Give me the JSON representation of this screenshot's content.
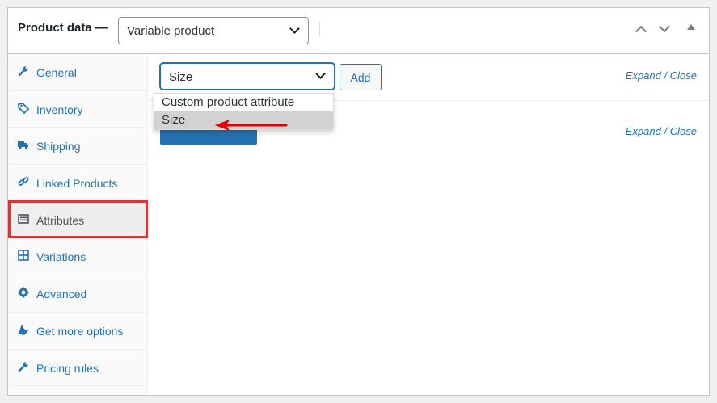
{
  "header": {
    "title": "Product data —",
    "product_type": "Variable product"
  },
  "sidebar": {
    "items": [
      {
        "label": "General",
        "icon": "wrench-icon"
      },
      {
        "label": "Inventory",
        "icon": "tag-icon"
      },
      {
        "label": "Shipping",
        "icon": "truck-icon"
      },
      {
        "label": "Linked Products",
        "icon": "link-icon"
      },
      {
        "label": "Attributes",
        "icon": "table-icon"
      },
      {
        "label": "Variations",
        "icon": "grid-icon"
      },
      {
        "label": "Advanced",
        "icon": "gear-icon"
      },
      {
        "label": "Get more options",
        "icon": "plug-icon"
      },
      {
        "label": "Pricing rules",
        "icon": "wrench-icon"
      }
    ],
    "active": "Attributes"
  },
  "toolbar": {
    "attribute_select": "Size",
    "add_label": "Add",
    "expand_label": "Expand",
    "separator": "/",
    "close_label": "Close"
  },
  "dropdown": {
    "options": [
      "Custom product attribute",
      "Size"
    ],
    "selected": "Size"
  },
  "colors": {
    "accent": "#2271b1",
    "highlight": "#d63638",
    "arrow": "#e00000"
  }
}
